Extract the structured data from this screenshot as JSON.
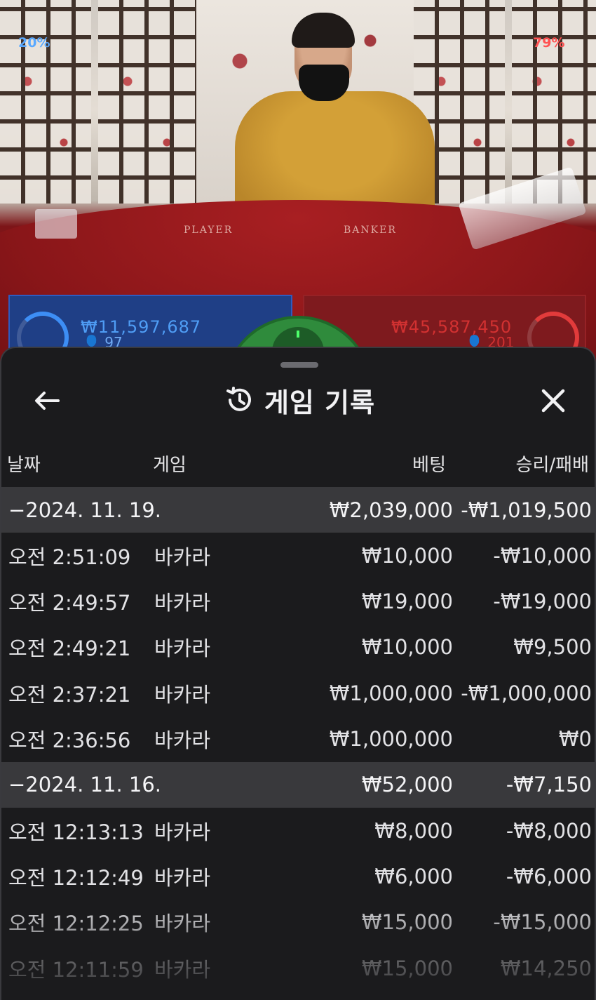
{
  "video": {
    "table_labels": {
      "player": "PLAYER",
      "banker": "BANKER"
    },
    "player": {
      "percent": "20%",
      "amount": "₩11,597,687",
      "players": "97",
      "color": "#3d8ef5"
    },
    "banker": {
      "percent": "79%",
      "amount": "₩45,587,450",
      "players": "201",
      "color": "#e23b3b"
    }
  },
  "sheet": {
    "title": "게임 기록",
    "icons": {
      "back": "arrow-left-icon",
      "history": "history-icon",
      "close": "close-icon"
    },
    "columns": {
      "date": "날짜",
      "game": "게임",
      "bet": "베팅",
      "win_loss": "승리/패배"
    },
    "groups": [
      {
        "date": "−2024. 11. 19.",
        "bet_total": "₩2,039,000",
        "win_total": "-₩1,019,500",
        "rows": [
          {
            "time": "오전 2:51:09",
            "game": "바카라",
            "bet": "₩10,000",
            "win": "-₩10,000"
          },
          {
            "time": "오전 2:49:57",
            "game": "바카라",
            "bet": "₩19,000",
            "win": "-₩19,000"
          },
          {
            "time": "오전 2:49:21",
            "game": "바카라",
            "bet": "₩10,000",
            "win": "₩9,500"
          },
          {
            "time": "오전 2:37:21",
            "game": "바카라",
            "bet": "₩1,000,000",
            "win": "-₩1,000,000"
          },
          {
            "time": "오전 2:36:56",
            "game": "바카라",
            "bet": "₩1,000,000",
            "win": "₩0"
          }
        ]
      },
      {
        "date": "−2024. 11. 16.",
        "bet_total": "₩52,000",
        "win_total": "-₩7,150",
        "rows": [
          {
            "time": "오전 12:13:13",
            "game": "바카라",
            "bet": "₩8,000",
            "win": "-₩8,000"
          },
          {
            "time": "오전 12:12:49",
            "game": "바카라",
            "bet": "₩6,000",
            "win": "-₩6,000"
          },
          {
            "time": "오전 12:12:25",
            "game": "바카라",
            "bet": "₩15,000",
            "win": "-₩15,000"
          },
          {
            "time": "오전 12:11:59",
            "game": "바카라",
            "bet": "₩15,000",
            "win": "₩14,250"
          }
        ]
      }
    ]
  }
}
